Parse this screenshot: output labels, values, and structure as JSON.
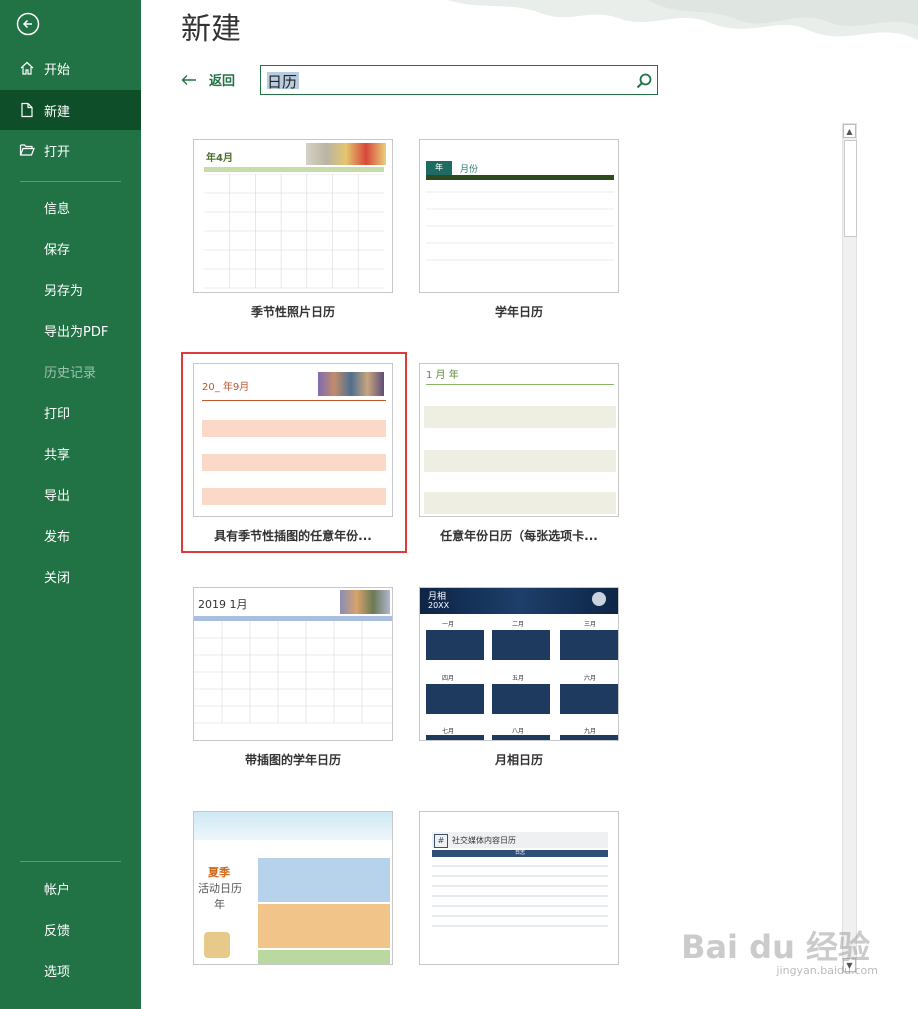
{
  "sidebar": {
    "items": [
      {
        "label": "开始"
      },
      {
        "label": "新建"
      },
      {
        "label": "打开"
      },
      {
        "label": "信息"
      },
      {
        "label": "保存"
      },
      {
        "label": "另存为"
      },
      {
        "label": "导出为PDF"
      },
      {
        "label": "历史记录"
      },
      {
        "label": "打印"
      },
      {
        "label": "共享"
      },
      {
        "label": "导出"
      },
      {
        "label": "发布"
      },
      {
        "label": "关闭"
      }
    ],
    "bottom": [
      {
        "label": "帐户"
      },
      {
        "label": "反馈"
      },
      {
        "label": "选项"
      }
    ]
  },
  "main": {
    "title": "新建",
    "back_label": "返回",
    "search": {
      "value": "日历"
    }
  },
  "templates": [
    {
      "label": "季节性照片日历",
      "thumb_title": "年4月"
    },
    {
      "label": "学年日历",
      "thumb_title": "年",
      "thumb_sub": "月份"
    },
    {
      "label": "具有季节性插图的任意年份...",
      "thumb_title": "20_ 年9月"
    },
    {
      "label": "任意年份日历（每张选项卡...",
      "thumb_title": "1 月 年"
    },
    {
      "label": "带插图的学年日历",
      "thumb_title": "2019 1月"
    },
    {
      "label": "月相日历",
      "thumb_title": "月相",
      "thumb_sub": "20XX",
      "months": [
        "一月",
        "二月",
        "三月",
        "四月",
        "五月",
        "六月",
        "七月",
        "八月",
        "九月"
      ]
    },
    {
      "label": "",
      "thumb_title": "夏季",
      "thumb_sub": "活动日历",
      "thumb_sub2": "年"
    },
    {
      "label": "",
      "thumb_title": "社交媒体内容日历",
      "thumb_sub": "日志"
    }
  ],
  "watermark": {
    "text": "Bai du 经验",
    "sub": "jingyan.baidu.com"
  },
  "colors": {
    "sidebar": "#217346",
    "active": "#0e4f2a",
    "highlight": "#e0393a"
  }
}
